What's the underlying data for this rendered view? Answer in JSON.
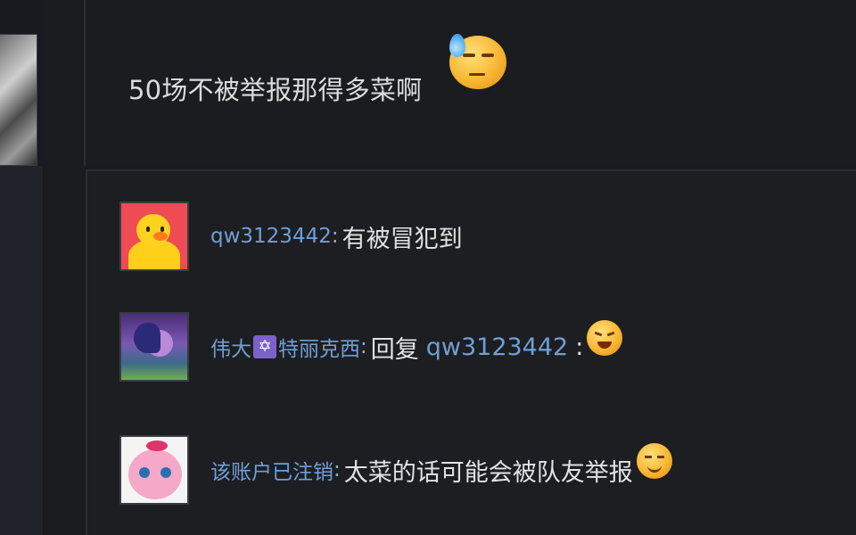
{
  "main_comment": {
    "text": "50场不被举报那得多菜啊",
    "emoji": "sweat-smile-emoji"
  },
  "replies": [
    {
      "username": "qw3123442",
      "separator": ":",
      "text": "有被冒犯到",
      "avatar": "yellow-duck-avatar"
    },
    {
      "username_part1": "伟大",
      "badge": "✡",
      "username_part2": "特丽克西",
      "separator": ":",
      "text": "回复",
      "mention": "qw3123442",
      "mention_suffix": ":",
      "emoji": "angry-laugh-emoji",
      "avatar": "pony-avatar"
    },
    {
      "username": "该账户已注销",
      "separator": ":",
      "text": "太菜的话可能会被队友举报",
      "emoji": "smile-emoji",
      "avatar": "jigglypuff-avatar"
    }
  ],
  "colors": {
    "background": "#1a1b1f",
    "username": "#6f9fd6",
    "text": "#e2e2e2",
    "emoji": "#f7b733"
  }
}
